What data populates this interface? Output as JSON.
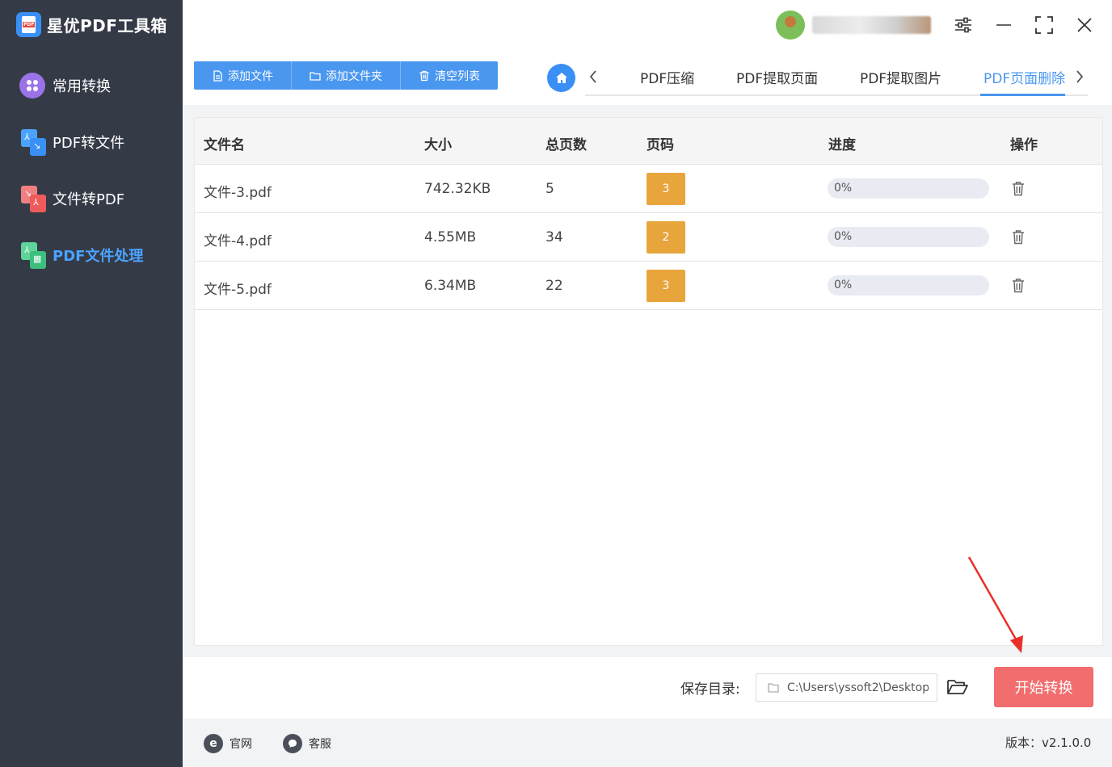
{
  "app": {
    "title": "星优PDF工具箱"
  },
  "sidebar": {
    "items": [
      {
        "label": "常用转换",
        "active": false
      },
      {
        "label": "PDF转文件",
        "active": false
      },
      {
        "label": "文件转PDF",
        "active": false
      },
      {
        "label": "PDF文件处理",
        "active": true
      }
    ]
  },
  "toolbar": {
    "add_file": "添加文件",
    "add_folder": "添加文件夹",
    "clear_list": "清空列表"
  },
  "tabs": [
    {
      "label": "PDF压缩",
      "active": false
    },
    {
      "label": "PDF提取页面",
      "active": false
    },
    {
      "label": "PDF提取图片",
      "active": false
    },
    {
      "label": "PDF页面删除",
      "active": true
    }
  ],
  "table": {
    "headers": [
      "文件名",
      "大小",
      "总页数",
      "页码",
      "进度",
      "操作"
    ],
    "rows": [
      {
        "name": "文件-3.pdf",
        "size": "742.32KB",
        "pages": "5",
        "page_code": "3",
        "progress": "0%",
        "progress_value": 0
      },
      {
        "name": "文件-4.pdf",
        "size": "4.55MB",
        "pages": "34",
        "page_code": "2",
        "progress": "0%",
        "progress_value": 0
      },
      {
        "name": "文件-5.pdf",
        "size": "6.34MB",
        "pages": "22",
        "page_code": "3",
        "progress": "0%",
        "progress_value": 0
      }
    ]
  },
  "bottom": {
    "save_label": "保存目录:",
    "save_path": "C:\\Users\\yssoft2\\Desktop",
    "start_button": "开始转换"
  },
  "footer": {
    "website": "官网",
    "support": "客服",
    "version": "版本：v2.1.0.0"
  },
  "colors": {
    "sidebar_bg": "#353a47",
    "accent": "#4a97f0",
    "badge": "#e8a53c",
    "start": "#f26d6d",
    "annotation_arrow": "#e8302a"
  }
}
